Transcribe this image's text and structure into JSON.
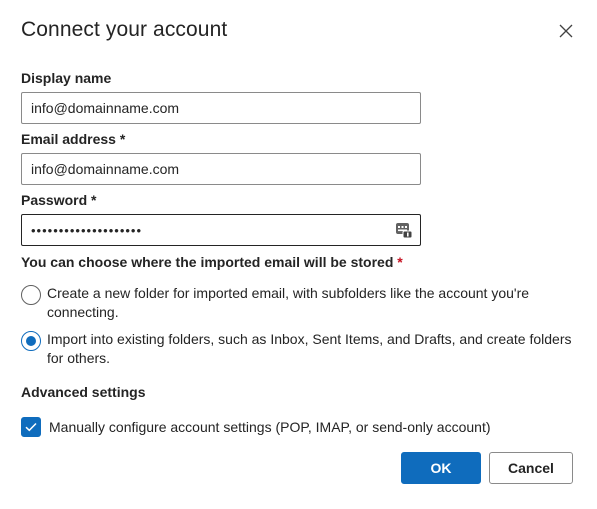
{
  "dialog": {
    "title": "Connect your account",
    "close_icon": "close-icon"
  },
  "fields": {
    "display_name": {
      "label": "Display name",
      "value": "info@domainname.com"
    },
    "email": {
      "label": "Email address",
      "required_mark": "*",
      "value": "info@domainname.com"
    },
    "password": {
      "label": "Password",
      "required_mark": "*",
      "value": "••••••••••••••••••••",
      "icon": "key-icon"
    }
  },
  "storage": {
    "question": "You can choose where the imported email will be stored",
    "required_mark": "*",
    "options": [
      {
        "label": "Create a new folder for imported email, with subfolders like the account you're connecting.",
        "selected": false
      },
      {
        "label": "Import into existing folders, such as Inbox, Sent Items, and Drafts, and create folders for others.",
        "selected": true
      }
    ]
  },
  "advanced": {
    "heading": "Advanced settings",
    "manual_config_label": "Manually configure account settings (POP, IMAP, or send-only account)",
    "manual_config_checked": true
  },
  "buttons": {
    "ok_label": "OK",
    "cancel_label": "Cancel"
  },
  "colors": {
    "accent": "#0f6cbd",
    "required": "#c50f1f"
  }
}
